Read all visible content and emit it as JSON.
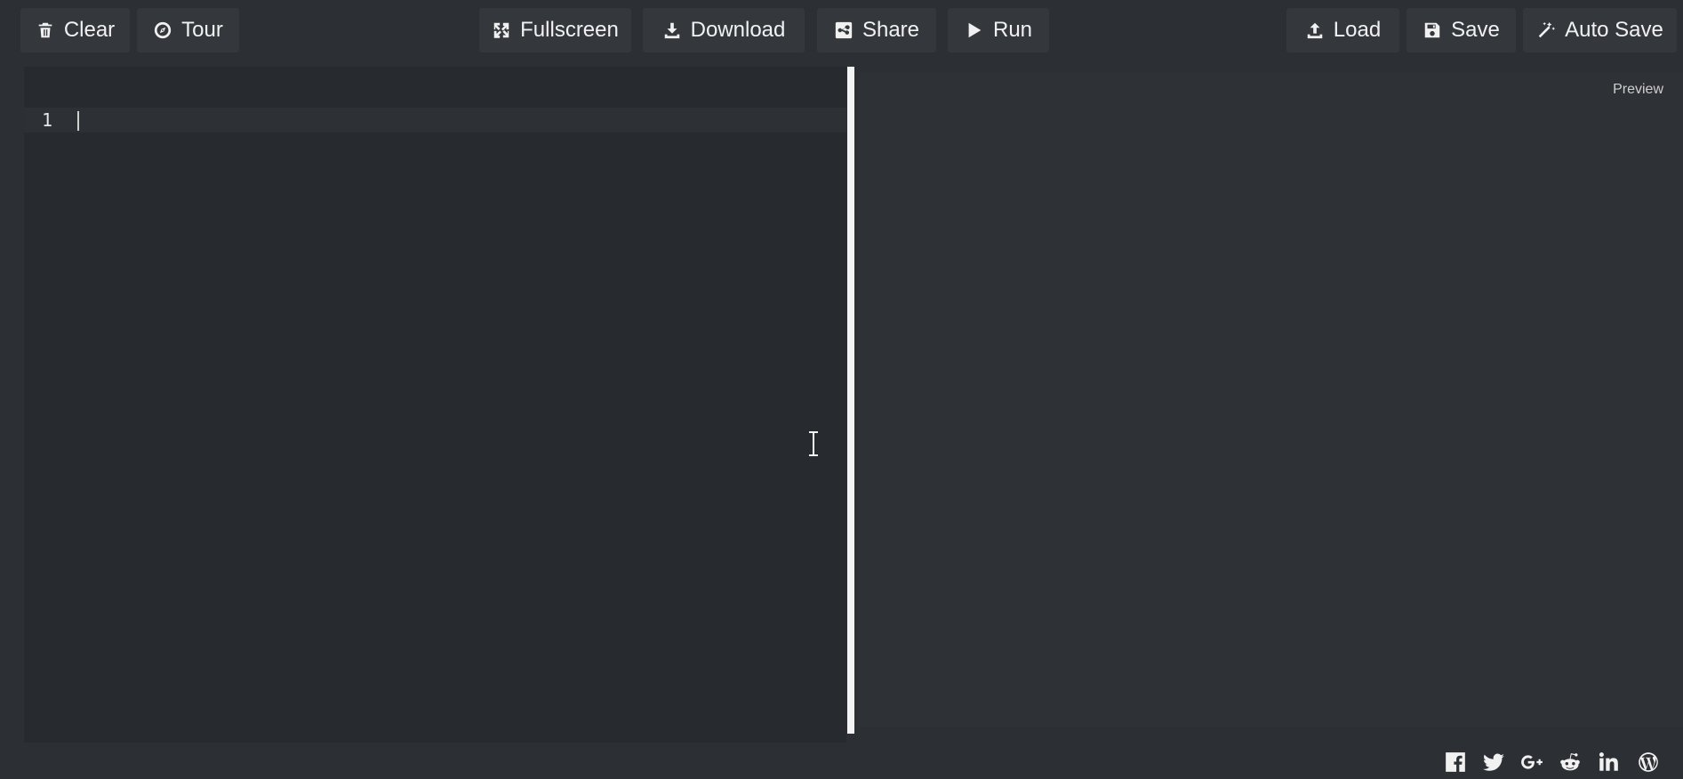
{
  "toolbar": {
    "clear": {
      "label": "Clear",
      "icon": "trash-icon"
    },
    "tour": {
      "label": "Tour",
      "icon": "compass-icon"
    },
    "fullscreen": {
      "label": "Fullscreen",
      "icon": "expand-icon"
    },
    "download": {
      "label": "Download",
      "icon": "download-icon"
    },
    "share": {
      "label": "Share",
      "icon": "share-icon"
    },
    "run": {
      "label": "Run",
      "icon": "play-icon"
    },
    "load": {
      "label": "Load",
      "icon": "upload-icon"
    },
    "save": {
      "label": "Save",
      "icon": "floppy-icon"
    },
    "autosave": {
      "label": "Auto Save",
      "icon": "magic-wand-icon"
    }
  },
  "editor": {
    "line_numbers": [
      "1"
    ]
  },
  "preview": {
    "label": "Preview"
  },
  "footer": {
    "social": [
      "facebook-icon",
      "twitter-icon",
      "google-plus-icon",
      "reddit-icon",
      "linkedin-icon",
      "wordpress-icon"
    ]
  },
  "colors": {
    "background": "#2c2f33",
    "button": "#34383d",
    "editor": "#272a2e",
    "preview": "#2e3135",
    "splitter": "#f4f4f4",
    "text": "#f1f1f1"
  }
}
